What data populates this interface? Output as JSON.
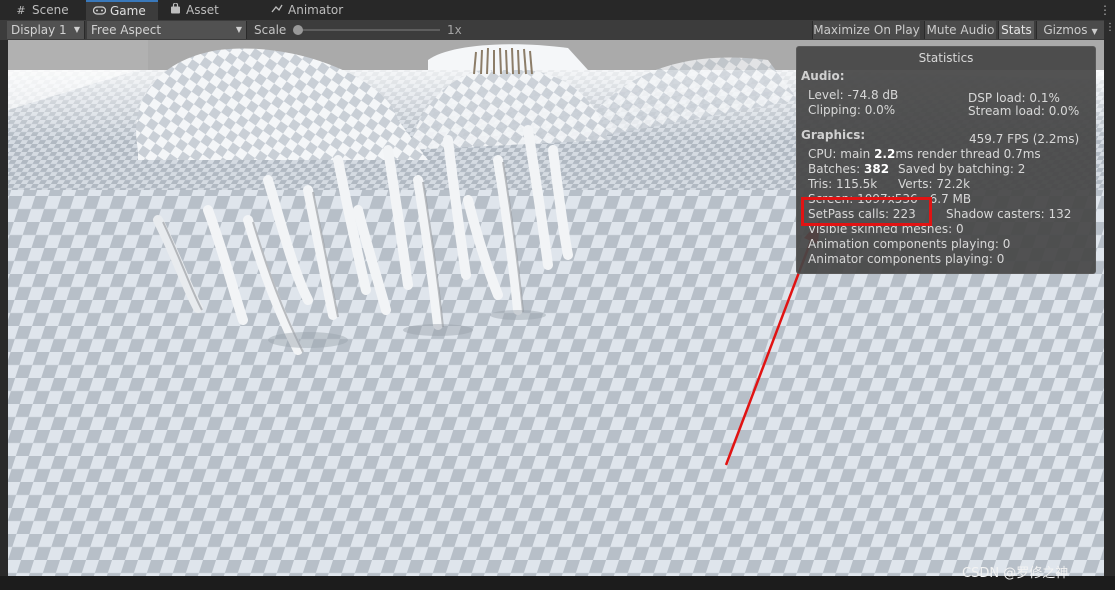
{
  "tabs": [
    {
      "label": "Scene",
      "icon": "grid-icon",
      "active": false
    },
    {
      "label": "Game",
      "icon": "gamepad-icon",
      "active": true
    },
    {
      "label": "Asset Store",
      "icon": "bag-icon",
      "active": false
    },
    {
      "label": "Animator",
      "icon": "animator-icon",
      "active": false
    }
  ],
  "toolbar": {
    "display": "Display 1",
    "aspect": "Free Aspect",
    "scale_label": "Scale",
    "scale_value": "1x",
    "scale_fraction": 0.0,
    "maximize_on_play": "Maximize On Play",
    "mute_audio": "Mute Audio",
    "stats": "Stats",
    "gizmos": "Gizmos"
  },
  "stats": {
    "title": "Statistics",
    "audio_header": "Audio:",
    "level": "Level: -74.8 dB",
    "clipping": "Clipping: 0.0%",
    "dsp_load": "DSP load: 0.1%",
    "stream_load": "Stream load: 0.0%",
    "graphics_header": "Graphics:",
    "fps": "459.7 FPS (2.2ms)",
    "cpu_prefix": "CPU: main ",
    "cpu_main": "2.2",
    "cpu_suffix": "ms  render thread 0.7ms",
    "batches_prefix": "Batches: ",
    "batches_value": "382",
    "saved_by_batching": "Saved by batching: 2",
    "tris": "Tris: 115.5k",
    "verts": "Verts: 72.2k",
    "screen": "Screen: 1097x536 - 6.7 MB",
    "setpass": "SetPass calls: 223",
    "shadow_casters": "Shadow casters: 132",
    "visible_skinned": "Visible skinned meshes: 0",
    "animation_components": "Animation components playing: 0",
    "animator_components": "Animator components playing: 0"
  },
  "annotation": {
    "highlight_color": "#e11313",
    "arrow_color": "#e11313"
  },
  "watermark": "CSDN @罗修之神",
  "colors": {
    "accent": "#3a79bb",
    "panel": "#3c3c3c",
    "checker_light": "#dfe5ec",
    "checker_dark": "#b7bfc8"
  }
}
